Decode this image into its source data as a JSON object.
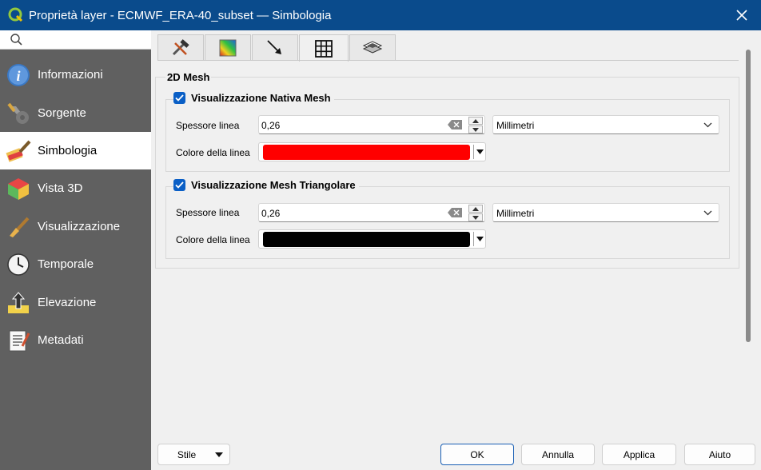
{
  "window": {
    "title": "Proprietà layer - ECMWF_ERA-40_subset — Simbologia"
  },
  "sidebar": {
    "items": [
      {
        "label": "Informazioni",
        "icon": "info-icon"
      },
      {
        "label": "Sorgente",
        "icon": "source-settings-icon"
      },
      {
        "label": "Simbologia",
        "icon": "symbology-brush-icon"
      },
      {
        "label": "Vista 3D",
        "icon": "cube-3d-icon"
      },
      {
        "label": "Visualizzazione",
        "icon": "rendering-brush-icon"
      },
      {
        "label": "Temporale",
        "icon": "clock-icon"
      },
      {
        "label": "Elevazione",
        "icon": "elevation-icon"
      },
      {
        "label": "Metadati",
        "icon": "metadata-icon"
      }
    ],
    "active": "Simbologia"
  },
  "tabs": [
    {
      "icon": "tools-icon"
    },
    {
      "icon": "color-ramp-icon"
    },
    {
      "icon": "vector-arrow-icon"
    },
    {
      "icon": "grid-mesh-icon",
      "active": true
    },
    {
      "icon": "layers-icon"
    }
  ],
  "panel": {
    "group_title": "2D Mesh",
    "native": {
      "title": "Visualizzazione Nativa Mesh",
      "checked": true,
      "width_label": "Spessore linea",
      "width_value": "0,26",
      "unit": "Millimetri",
      "color_label": "Colore della linea",
      "color": "#ff0000"
    },
    "triangular": {
      "title": "Visualizzazione Mesh Triangolare",
      "checked": true,
      "width_label": "Spessore linea",
      "width_value": "0,26",
      "unit": "Millimetri",
      "color_label": "Colore della linea",
      "color": "#000000"
    }
  },
  "footer": {
    "style": "Stile",
    "ok": "OK",
    "cancel": "Annulla",
    "apply": "Applica",
    "help": "Aiuto"
  }
}
